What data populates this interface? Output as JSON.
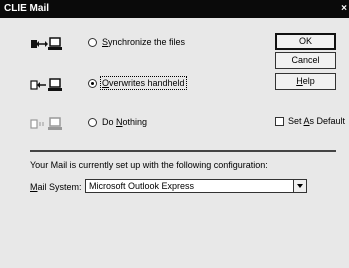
{
  "window": {
    "title": "CLIE Mail",
    "close_glyph": "×"
  },
  "options": [
    {
      "label": "Synchronize the files",
      "icon": "sync-both-ways-icon",
      "selected": false
    },
    {
      "label": "Overwrites handheld",
      "icon": "overwrite-handheld-icon",
      "selected": true
    },
    {
      "label": "Do Nothing",
      "icon": "do-nothing-icon",
      "selected": false
    }
  ],
  "buttons": {
    "ok": "OK",
    "cancel": "Cancel",
    "help": "Help"
  },
  "default_checkbox": {
    "label": "Set As Default",
    "checked": false
  },
  "config": {
    "message": "Your Mail is currently set up with the following configuration:",
    "mail_system_label": "Mail System:",
    "mail_system_value": "Microsoft Outlook Express"
  }
}
